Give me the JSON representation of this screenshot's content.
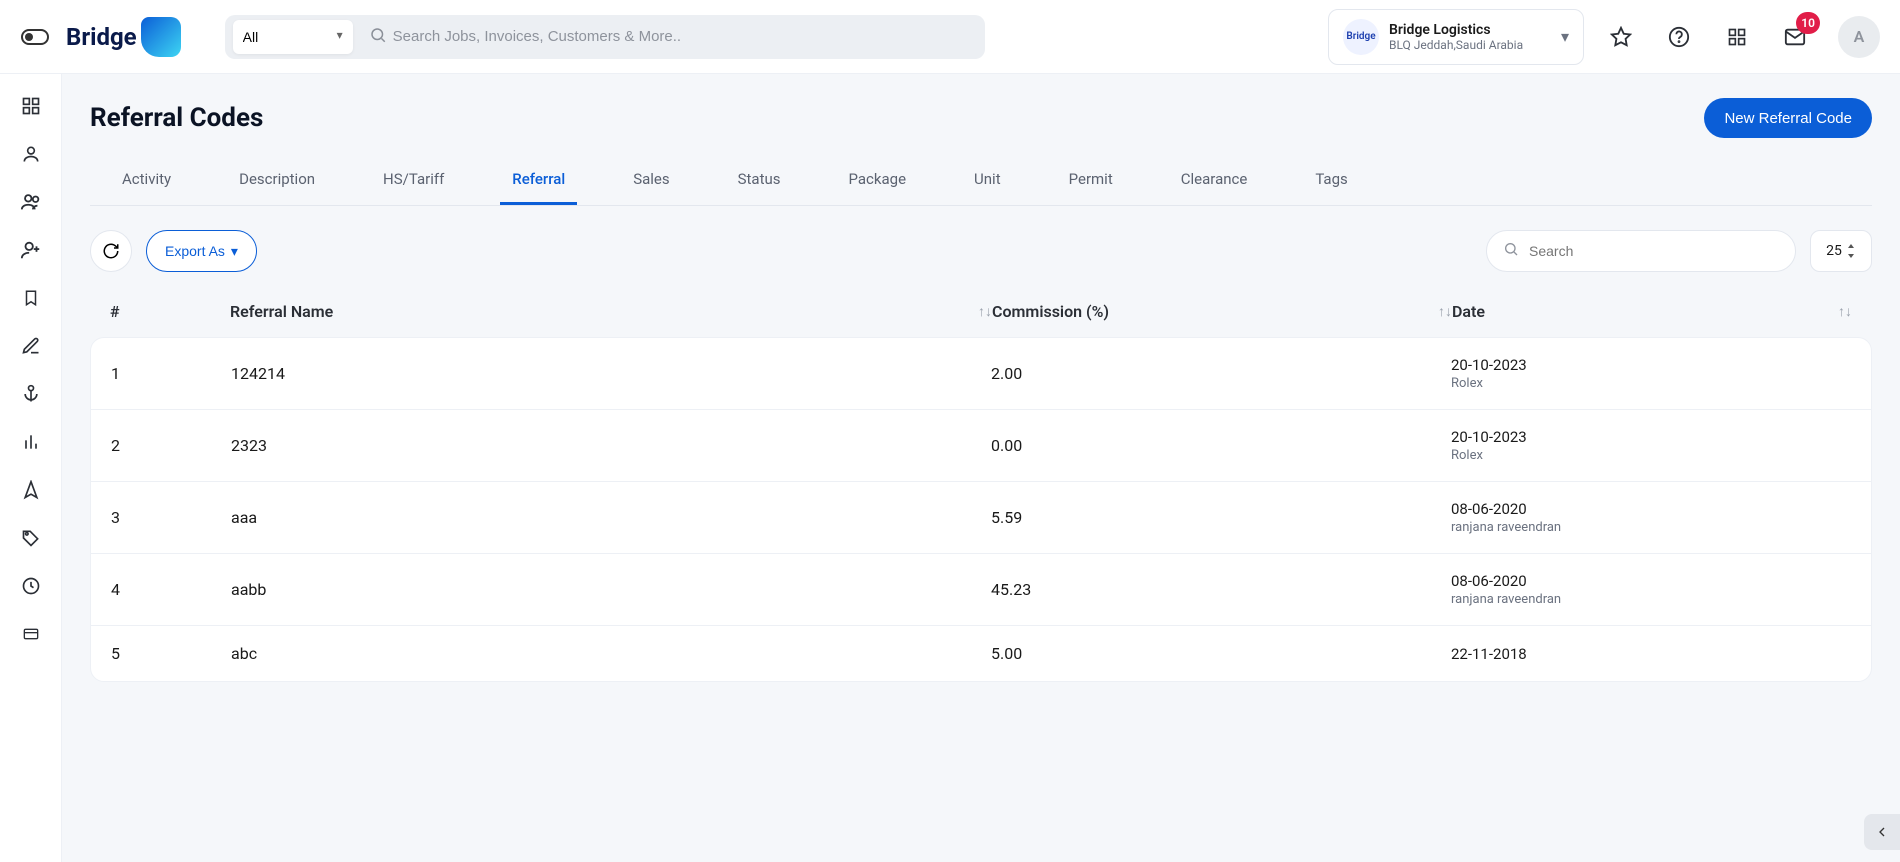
{
  "header": {
    "logo_text": "Bridge",
    "search_scope": "All",
    "search_placeholder": "Search Jobs, Invoices, Customers & More..",
    "org_name": "Bridge Logistics",
    "org_sub": "BLQ Jeddah,Saudi Arabia",
    "org_avatar_label": "Bridge",
    "mail_badge": "10",
    "user_initial": "A"
  },
  "page": {
    "title": "Referral Codes",
    "new_button": "New Referral Code"
  },
  "tabs": [
    {
      "label": "Activity",
      "active": false
    },
    {
      "label": "Description",
      "active": false
    },
    {
      "label": "HS/Tariff",
      "active": false
    },
    {
      "label": "Referral",
      "active": true
    },
    {
      "label": "Sales",
      "active": false
    },
    {
      "label": "Status",
      "active": false
    },
    {
      "label": "Package",
      "active": false
    },
    {
      "label": "Unit",
      "active": false
    },
    {
      "label": "Permit",
      "active": false
    },
    {
      "label": "Clearance",
      "active": false
    },
    {
      "label": "Tags",
      "active": false
    }
  ],
  "toolbar": {
    "export_label": "Export As",
    "search_placeholder": "Search",
    "page_size": "25"
  },
  "columns": {
    "index": "#",
    "name": "Referral Name",
    "commission": "Commission (%)",
    "date": "Date"
  },
  "rows": [
    {
      "idx": "1",
      "name": "124214",
      "commission": "2.00",
      "date": "20-10-2023",
      "by": "Rolex"
    },
    {
      "idx": "2",
      "name": "2323",
      "commission": "0.00",
      "date": "20-10-2023",
      "by": "Rolex"
    },
    {
      "idx": "3",
      "name": "aaa",
      "commission": "5.59",
      "date": "08-06-2020",
      "by": "ranjana raveendran"
    },
    {
      "idx": "4",
      "name": "aabb",
      "commission": "45.23",
      "date": "08-06-2020",
      "by": "ranjana raveendran"
    },
    {
      "idx": "5",
      "name": "abc",
      "commission": "5.00",
      "date": "22-11-2018",
      "by": ""
    }
  ]
}
